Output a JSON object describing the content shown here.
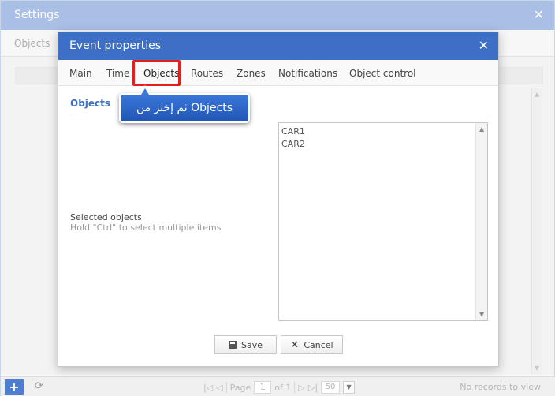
{
  "settings": {
    "title": "Settings",
    "close_icon": "close-icon",
    "tab_objects": "Objects",
    "footer": {
      "add_label": "+",
      "page_label": "Page",
      "page_value": "1",
      "of_label": "of 1",
      "page_size": "50",
      "no_records": "No records to view"
    }
  },
  "modal": {
    "title": "Event properties",
    "close_icon": "close-icon",
    "tabs": [
      {
        "label": "Main"
      },
      {
        "label": "Time"
      },
      {
        "label": "Objects"
      },
      {
        "label": "Routes"
      },
      {
        "label": "Zones"
      },
      {
        "label": "Notifications"
      },
      {
        "label": "Object control"
      }
    ],
    "active_tab": "Objects",
    "section_title": "Objects",
    "selected_label": "Selected objects",
    "selected_hint": "Hold \"Ctrl\" to select multiple items",
    "objects_list": [
      "CAR1",
      "CAR2"
    ],
    "save_label": "Save",
    "cancel_label": "Cancel"
  },
  "callout": {
    "text": "ثم إختر من Objects"
  },
  "colors": {
    "header_blue": "#3d6fc7",
    "highlight_red": "#e12020",
    "section_title": "#3c6fc4"
  }
}
